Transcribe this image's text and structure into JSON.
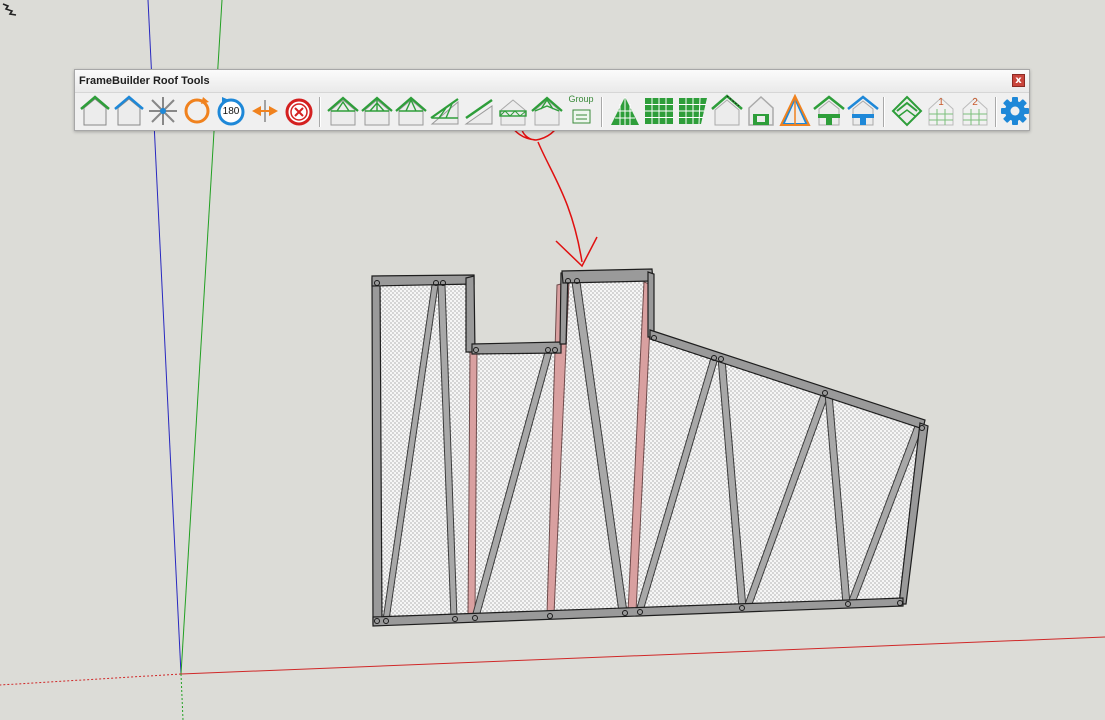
{
  "toolbar": {
    "title": "FrameBuilder Roof Tools",
    "close_label": "x",
    "buttons": [
      {
        "name": "gable-roof",
        "icon": "gable-roof-icon"
      },
      {
        "name": "hip-roof",
        "icon": "hip-roof-icon"
      },
      {
        "name": "move-components",
        "icon": "move-arrows-icon"
      },
      {
        "name": "rotate",
        "icon": "rotate-icon"
      },
      {
        "name": "rotate-180",
        "icon": "rotate-180-icon",
        "label": "180"
      },
      {
        "name": "flip",
        "icon": "flip-arrows-icon"
      },
      {
        "name": "delete",
        "icon": "delete-x-icon"
      },
      {
        "name": "truss-1",
        "icon": "truss-icon"
      },
      {
        "name": "truss-2",
        "icon": "truss-icon"
      },
      {
        "name": "truss-3",
        "icon": "truss-icon"
      },
      {
        "name": "mono-truss",
        "icon": "mono-truss-icon"
      },
      {
        "name": "rafter",
        "icon": "rafter-icon"
      },
      {
        "name": "flat-truss",
        "icon": "flat-truss-icon"
      },
      {
        "name": "scissor-truss",
        "icon": "scissor-truss-icon"
      },
      {
        "name": "group",
        "icon": "group-icon",
        "label": "Group"
      },
      {
        "name": "sheathing-gable",
        "icon": "sheathing-gable-icon"
      },
      {
        "name": "sheathing-grid",
        "icon": "sheathing-grid-icon"
      },
      {
        "name": "sheathing-slant",
        "icon": "sheathing-slant-icon"
      },
      {
        "name": "fascia",
        "icon": "fascia-icon"
      },
      {
        "name": "gable-wall",
        "icon": "gable-wall-icon"
      },
      {
        "name": "truss-outline",
        "icon": "truss-outline-icon"
      },
      {
        "name": "overhang-1",
        "icon": "overhang-icon"
      },
      {
        "name": "overhang-2",
        "icon": "overhang-blue-icon"
      },
      {
        "name": "dormer",
        "icon": "dormer-icon"
      },
      {
        "name": "layer-1",
        "icon": "layer-1-icon",
        "label": "1"
      },
      {
        "name": "layer-2",
        "icon": "layer-2-icon",
        "label": "2"
      },
      {
        "name": "settings",
        "icon": "gear-icon"
      }
    ]
  },
  "colors": {
    "background": "#dcdcd7",
    "accent_green": "#2e9e3a",
    "accent_blue": "#1e88d8",
    "accent_orange": "#f0821e",
    "accent_red": "#d42020",
    "annotation_red": "#e01010",
    "axis_red": "#d02020",
    "axis_green": "#20a020",
    "axis_blue": "#2020c0"
  },
  "viewport": {
    "object": "truss-frame-model",
    "annotation": "red-circle-arrow-to-group-button"
  }
}
